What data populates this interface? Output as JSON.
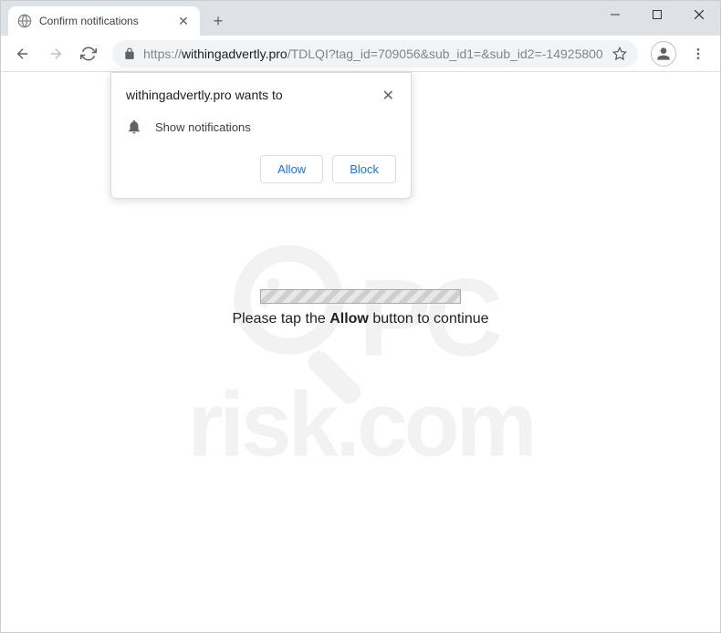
{
  "tab": {
    "title": "Confirm notifications"
  },
  "url": {
    "protocol": "https://",
    "host": "withingadvertly.pro",
    "path": "/TDLQI?tag_id=709056&sub_id1=&sub_id2=-14925800"
  },
  "permission": {
    "title": "withingadvertly.pro wants to",
    "item": "Show notifications",
    "allow": "Allow",
    "block": "Block"
  },
  "page": {
    "msg_pre": "Please tap the ",
    "msg_bold": "Allow",
    "msg_post": " button to continue"
  },
  "watermark": {
    "line1": "PC",
    "line2": "risk.com"
  }
}
